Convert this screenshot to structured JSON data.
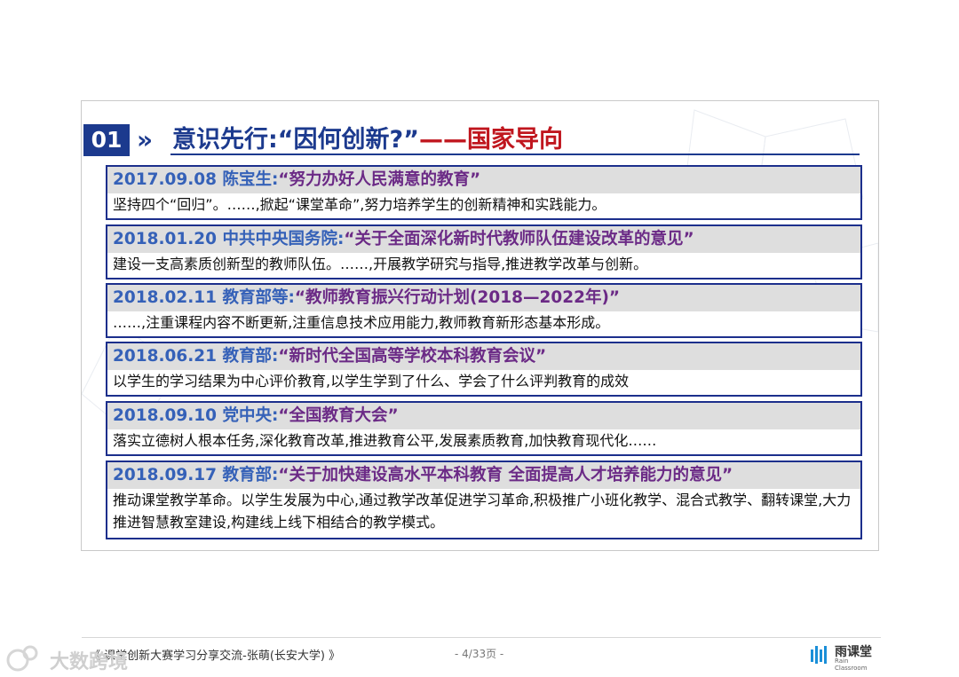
{
  "slide": {
    "number": "01",
    "chevron": "»",
    "title_main": "意识先行:“因何创新?”",
    "title_accent": "——国家导向",
    "items": [
      {
        "date": "2017.09.08 陈宝生:",
        "quote": "“努力办好人民满意的教育”",
        "body": "坚持四个“回归”。……,掀起“课堂革命”,努力培养学生的创新精神和实践能力。"
      },
      {
        "date": "2018.01.20 中共中央国务院:",
        "quote": "“关于全面深化新时代教师队伍建设改革的意见”",
        "body": "建设一支高素质创新型的教师队伍。……,开展教学研究与指导,推进教学改革与创新。"
      },
      {
        "date": "2018.02.11 教育部等:",
        "quote": "“教师教育振兴行动计划(2018—2022年)”",
        "body": "……,注重课程内容不断更新,注重信息技术应用能力,教师教育新形态基本形成。"
      },
      {
        "date": "2018.06.21 教育部:",
        "quote": "“新时代全国高等学校本科教育会议”",
        "body": "以学生的学习结果为中心评价教育,以学生学到了什么、学会了什么评判教育的成效"
      },
      {
        "date": "2018.09.10 党中央:",
        "quote": "“全国教育大会”",
        "body": "落实立德树人根本任务,深化教育改革,推进教育公平,发展素质教育,加快教育现代化……"
      },
      {
        "date": "2018.09.17 教育部:",
        "quote": "“关于加快建设高水平本科教育 全面提高人才培养能力的意见”",
        "body": "推动课堂教学革命。以学生发展为中心,通过教学改革促进学习革命,积极推广小班化教学、混合式教学、翻转课堂,大力推进智慧教室建设,构建线上线下相结合的教学模式。"
      }
    ]
  },
  "footer": {
    "title": "《 课堂创新大赛学习分享交流-张萌(长安大学) 》",
    "page": "- 4/33页 -",
    "brand_name": "雨课堂",
    "brand_sub": "Rain Classroom",
    "watermark": "大数跨境"
  },
  "colors": {
    "navy": "#1c3a8e",
    "red": "#c0161e",
    "date_blue": "#3561b8",
    "quote_purple": "#6b2a86"
  }
}
